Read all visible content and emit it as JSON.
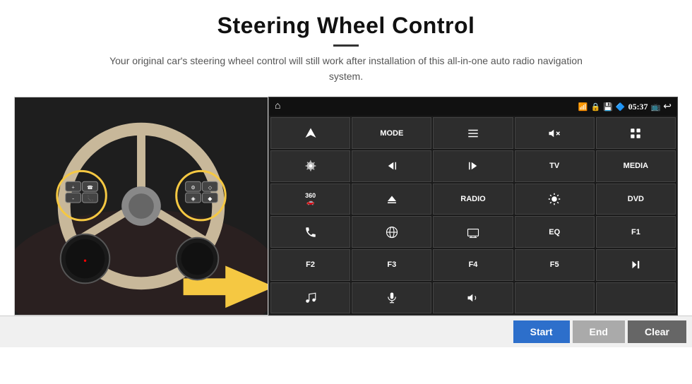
{
  "header": {
    "title": "Steering Wheel Control",
    "subtitle": "Your original car's steering wheel control will still work after installation of this all-in-one auto radio navigation system."
  },
  "status_bar": {
    "time": "05:37",
    "home_icon": "home-icon",
    "wifi_icon": "wifi-icon",
    "lock_icon": "lock-icon",
    "sd_icon": "sd-icon",
    "bt_icon": "bluetooth-icon",
    "screen_icon": "screen-icon",
    "back_icon": "back-icon"
  },
  "grid_buttons": [
    {
      "id": "nav",
      "type": "icon",
      "icon": "nav-icon",
      "label": "navigate"
    },
    {
      "id": "mode",
      "type": "text",
      "label": "MODE"
    },
    {
      "id": "list",
      "type": "icon",
      "icon": "list-icon",
      "label": "list"
    },
    {
      "id": "mute",
      "type": "icon",
      "icon": "mute-icon",
      "label": "mute"
    },
    {
      "id": "apps",
      "type": "icon",
      "icon": "apps-icon",
      "label": "apps"
    },
    {
      "id": "settings",
      "type": "icon",
      "icon": "settings-icon",
      "label": "settings"
    },
    {
      "id": "prev",
      "type": "icon",
      "icon": "prev-icon",
      "label": "previous"
    },
    {
      "id": "next",
      "type": "icon",
      "icon": "next-icon",
      "label": "next"
    },
    {
      "id": "tv",
      "type": "text",
      "label": "TV"
    },
    {
      "id": "media",
      "type": "text",
      "label": "MEDIA"
    },
    {
      "id": "360",
      "type": "icon",
      "icon": "360-icon",
      "label": "360 camera"
    },
    {
      "id": "eject",
      "type": "icon",
      "icon": "eject-icon",
      "label": "eject"
    },
    {
      "id": "radio",
      "type": "text",
      "label": "RADIO"
    },
    {
      "id": "bright",
      "type": "icon",
      "icon": "brightness-icon",
      "label": "brightness"
    },
    {
      "id": "dvd",
      "type": "text",
      "label": "DVD"
    },
    {
      "id": "phone",
      "type": "icon",
      "icon": "phone-icon",
      "label": "phone"
    },
    {
      "id": "browser",
      "type": "icon",
      "icon": "browser-icon",
      "label": "browser"
    },
    {
      "id": "screen",
      "type": "icon",
      "icon": "screen-icon",
      "label": "screen"
    },
    {
      "id": "eq",
      "type": "text",
      "label": "EQ"
    },
    {
      "id": "f1",
      "type": "text",
      "label": "F1"
    },
    {
      "id": "f2",
      "type": "text",
      "label": "F2"
    },
    {
      "id": "f3",
      "type": "text",
      "label": "F3"
    },
    {
      "id": "f4",
      "type": "text",
      "label": "F4"
    },
    {
      "id": "f5",
      "type": "text",
      "label": "F5"
    },
    {
      "id": "playpause",
      "type": "icon",
      "icon": "play-pause-icon",
      "label": "play pause"
    },
    {
      "id": "music",
      "type": "icon",
      "icon": "music-icon",
      "label": "music"
    },
    {
      "id": "mic",
      "type": "icon",
      "icon": "microphone-icon",
      "label": "microphone"
    },
    {
      "id": "vol",
      "type": "icon",
      "icon": "volume-icon",
      "label": "volume"
    },
    {
      "id": "empty1",
      "type": "empty",
      "label": ""
    },
    {
      "id": "empty2",
      "type": "empty",
      "label": ""
    }
  ],
  "bottom_bar": {
    "start_label": "Start",
    "end_label": "End",
    "clear_label": "Clear"
  }
}
